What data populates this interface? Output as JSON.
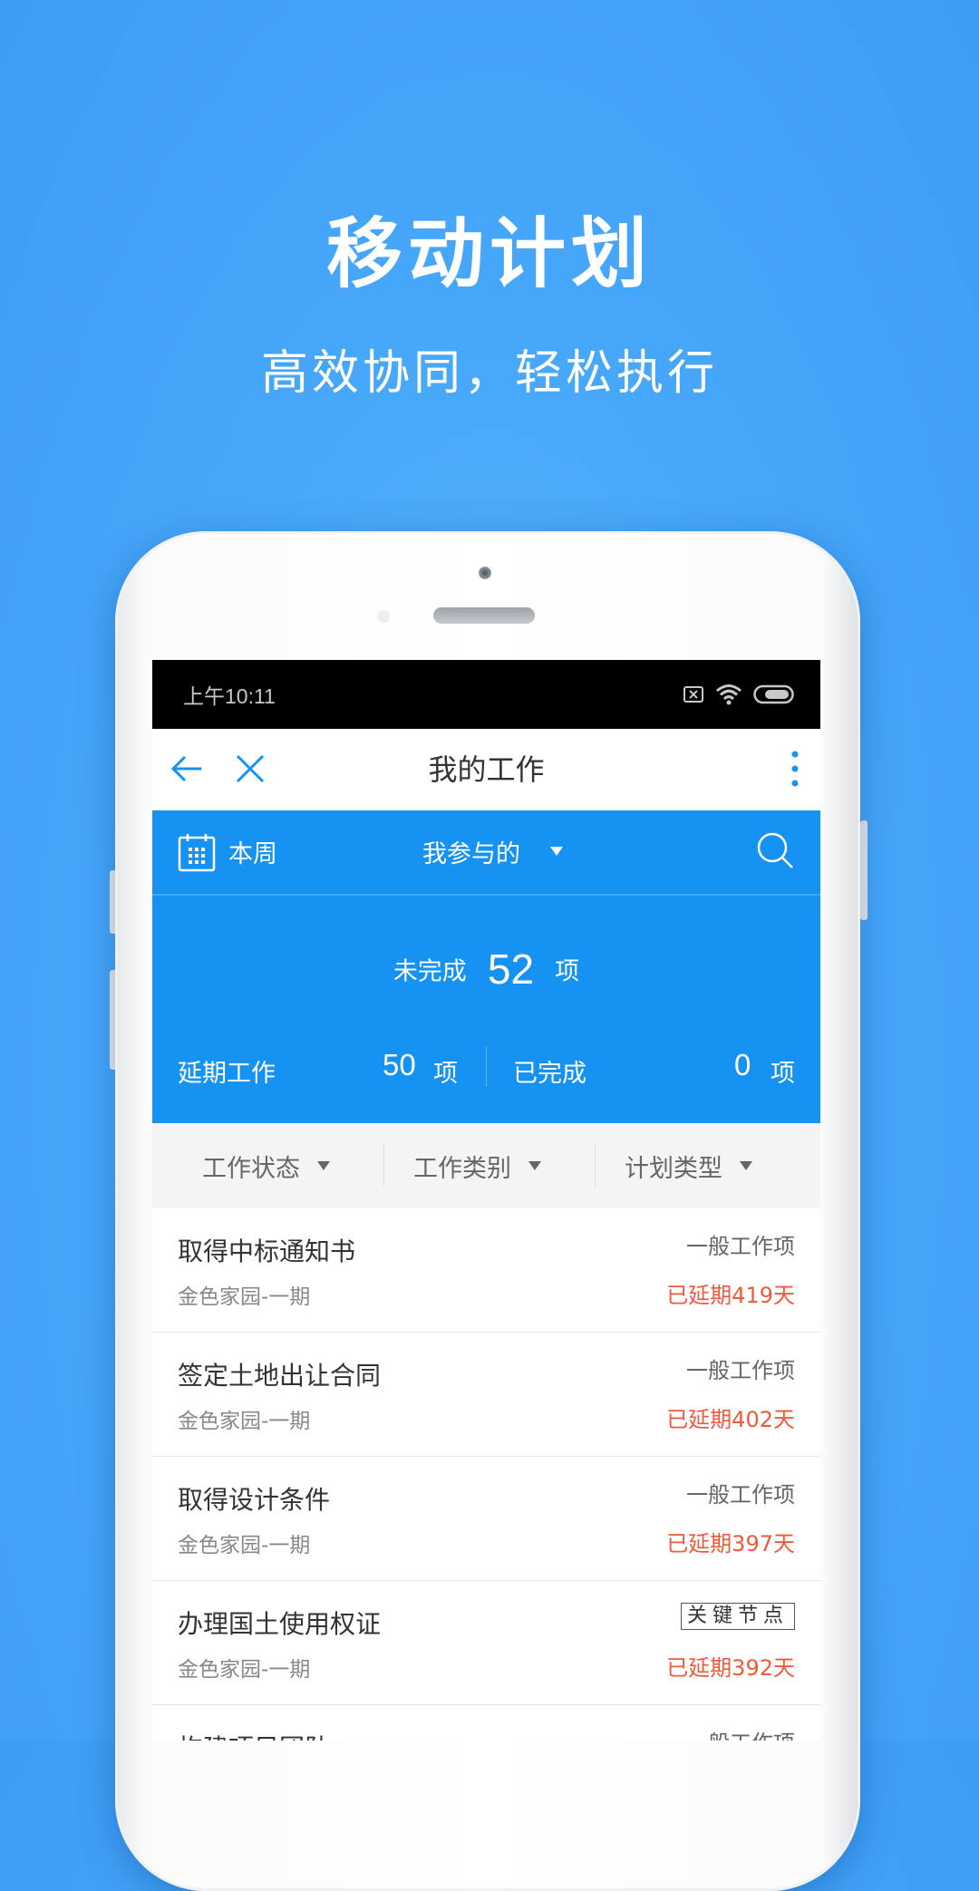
{
  "hero": {
    "title": "移动计划",
    "subtitle": "高效协同，轻松执行"
  },
  "statusbar": {
    "time": "上午10:11",
    "icons": [
      "sim-x-icon",
      "wifi-icon",
      "battery-icon"
    ]
  },
  "appbar": {
    "title": "我的工作",
    "icons": [
      "back-arrow-icon",
      "close-icon",
      "more-vertical-icon"
    ]
  },
  "toolbar": {
    "period": "本周",
    "filter": "我参与的"
  },
  "stats": {
    "incomplete_label": "未完成",
    "incomplete_count": "52",
    "unit": "项",
    "delayed_label": "延期工作",
    "delayed_count": "50",
    "completed_label": "已完成",
    "completed_count": "0"
  },
  "filters": [
    {
      "label": "工作状态"
    },
    {
      "label": "工作类别"
    },
    {
      "label": "计划类型"
    }
  ],
  "items": [
    {
      "title": "取得中标通知书",
      "project": "金色家园-一期",
      "type": "一般工作项",
      "delay": "已延期419天"
    },
    {
      "title": "签定土地出让合同",
      "project": "金色家园-一期",
      "type": "一般工作项",
      "delay": "已延期402天"
    },
    {
      "title": "取得设计条件",
      "project": "金色家园-一期",
      "type": "一般工作项",
      "delay": "已延期397天"
    },
    {
      "title": "办理国土使用权证",
      "project": "金色家园-一期",
      "type": "关键节点",
      "delay": "已延期392天"
    },
    {
      "title": "构建项目团队",
      "project": "",
      "type": "一般工作项",
      "delay": ""
    }
  ],
  "colors": {
    "background": "#48a8fa",
    "panel": "#1592f2",
    "accent": "#1592f2",
    "delay": "#f05a3a"
  }
}
